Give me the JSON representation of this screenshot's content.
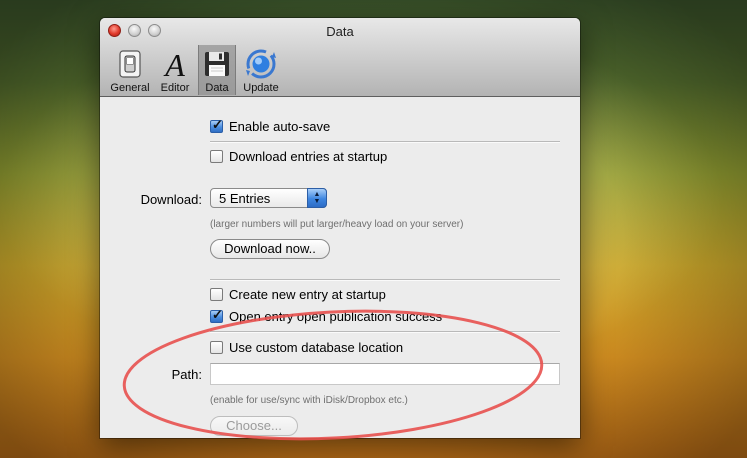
{
  "window": {
    "title": "Data"
  },
  "toolbar": {
    "items": [
      {
        "label": "General",
        "icon": "switch-icon"
      },
      {
        "label": "Editor",
        "icon": "font-a-icon"
      },
      {
        "label": "Data",
        "icon": "floppy-disk-icon",
        "selected": true
      },
      {
        "label": "Update",
        "icon": "sync-globe-icon"
      }
    ]
  },
  "options": {
    "auto_save": {
      "label": "Enable auto-save",
      "checked": true
    },
    "download_startup": {
      "label": "Download entries at startup",
      "checked": false
    },
    "download_label": "Download:",
    "download_select": {
      "value": "5 Entries"
    },
    "download_hint": "(larger numbers will put larger/heavy load on your server)",
    "download_button": "Download now..",
    "create_startup": {
      "label": "Create new entry at startup",
      "checked": false
    },
    "open_entry": {
      "label": "Open entry open publication success",
      "checked": true
    },
    "custom_db": {
      "label": "Use custom database location",
      "checked": false
    },
    "path_label": "Path:",
    "path_value": "",
    "path_hint": "(enable for use/sync with iDisk/Dropbox etc.)",
    "choose_button": "Choose..."
  },
  "colors": {
    "annotation": "#e8514f",
    "accent": "#3e86e0"
  }
}
